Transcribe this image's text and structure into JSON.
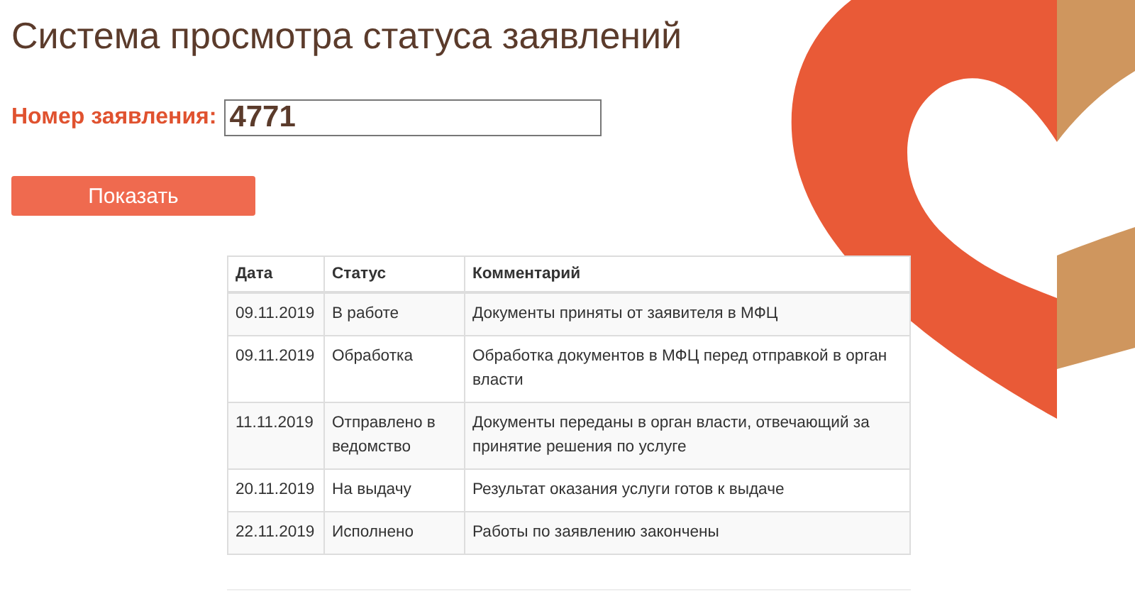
{
  "title": "Система просмотра статуса заявлений",
  "form": {
    "label": "Номер заявления:",
    "value": "4771"
  },
  "button": {
    "label": "Показать"
  },
  "table": {
    "columns": [
      "Дата",
      "Статус",
      "Комментарий"
    ],
    "rows": [
      {
        "date": "09.11.2019",
        "status": "В работе",
        "comment": "Документы приняты от заявителя в МФЦ"
      },
      {
        "date": "09.11.2019",
        "status": "Обработка",
        "comment": "Обработка документов в МФЦ перед отправкой в орган власти"
      },
      {
        "date": "11.11.2019",
        "status": "Отправлено в ведомство",
        "comment": "Документы переданы в орган власти, отвечающий за принятие решения по услуге"
      },
      {
        "date": "20.11.2019",
        "status": "На выдачу",
        "comment": "Результат оказания услуги готов к выдаче"
      },
      {
        "date": "22.11.2019",
        "status": "Исполнено",
        "comment": "Работы по заявлению закончены"
      }
    ]
  }
}
